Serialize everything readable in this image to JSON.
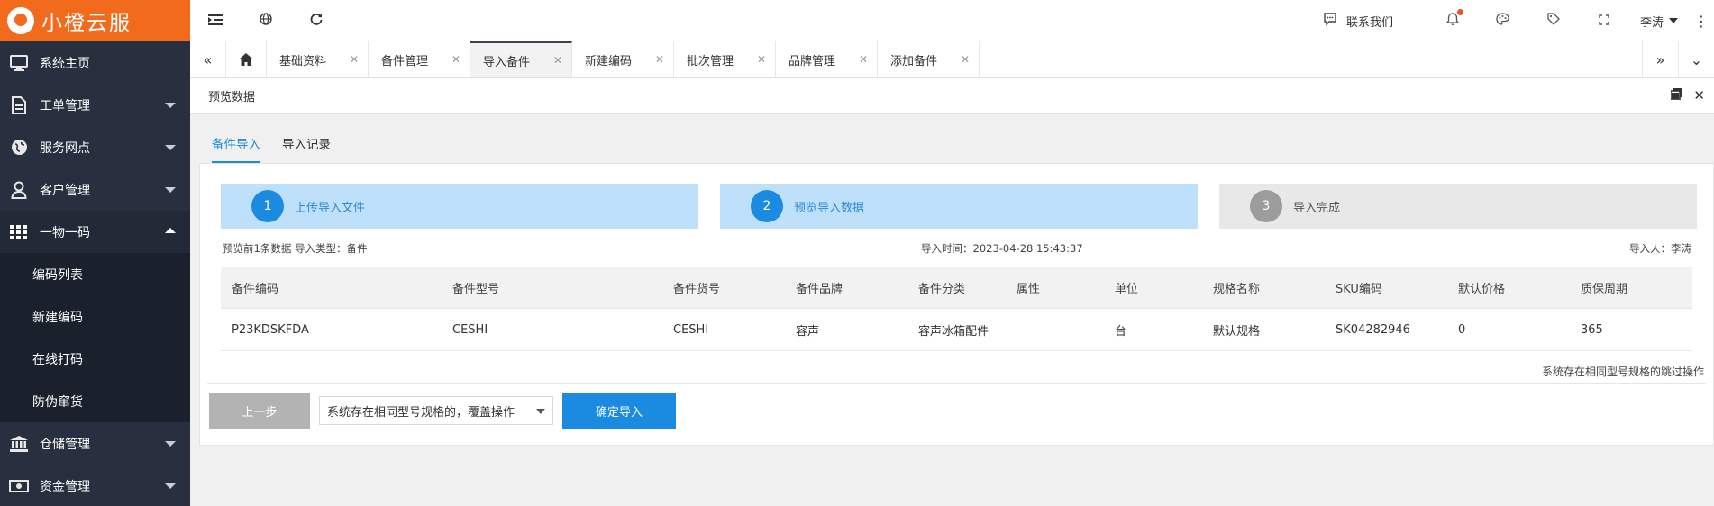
{
  "brand": {
    "name": "小橙云服",
    "color": "#f26b1d"
  },
  "sidebar": {
    "items": [
      {
        "label": "系统主页",
        "icon": "monitor-icon",
        "has_caret": false
      },
      {
        "label": "工单管理",
        "icon": "document-icon",
        "has_caret": true
      },
      {
        "label": "服务网点",
        "icon": "globe-icon",
        "has_caret": true
      },
      {
        "label": "客户管理",
        "icon": "user-icon",
        "has_caret": true
      },
      {
        "label": "一物一码",
        "icon": "grid-icon",
        "has_caret": true,
        "open": true
      }
    ],
    "subitems": [
      "编码列表",
      "新建编码",
      "在线打码",
      "防伪窜货"
    ],
    "items_after": [
      {
        "label": "仓储管理",
        "icon": "bank-icon"
      },
      {
        "label": "资金管理",
        "icon": "money-icon"
      }
    ]
  },
  "topbar": {
    "contact_label": "联系我们",
    "user_name": "李涛",
    "icons": [
      "menu-indent-icon",
      "globe-icon",
      "refresh-icon",
      "message-icon",
      "bell-icon",
      "palette-icon",
      "tag-icon",
      "fullscreen-icon",
      "more-icon"
    ]
  },
  "tabs": [
    {
      "label": "基础资料",
      "active": false
    },
    {
      "label": "备件管理",
      "active": false
    },
    {
      "label": "导入备件",
      "active": true
    },
    {
      "label": "新建编码",
      "active": false
    },
    {
      "label": "批次管理",
      "active": false
    },
    {
      "label": "品牌管理",
      "active": false
    },
    {
      "label": "添加备件",
      "active": false
    }
  ],
  "page": {
    "title": "预览数据",
    "subtabs": [
      "备件导入",
      "导入记录"
    ]
  },
  "steps": [
    {
      "num": "1",
      "label": "上传导入文件"
    },
    {
      "num": "2",
      "label": "预览导入数据"
    },
    {
      "num": "3",
      "label": "导入完成"
    }
  ],
  "meta": {
    "left": "预览前1条数据 导入类型：备件",
    "time": "导入时间：2023-04-28 15:43:37",
    "importer": "导入人：李涛"
  },
  "table": {
    "columns": [
      "备件编码",
      "备件型号",
      "备件货号",
      "备件品牌",
      "备件分类",
      "属性",
      "单位",
      "规格名称",
      "SKU编码",
      "默认价格",
      "质保周期"
    ],
    "rows": [
      [
        "P23KDSKFDA",
        "CESHI",
        "CESHI",
        "容声",
        "容声冰箱配件",
        "",
        "台",
        "默认规格",
        "SK04282946",
        "0",
        "365"
      ]
    ]
  },
  "note": "系统存在相同型号规格的跳过操作",
  "actions": {
    "prev_label": "上一步",
    "select_value": "系统存在相同型号规格的，覆盖操作",
    "confirm_label": "确定导入"
  },
  "colors": {
    "accent": "#1a8be0",
    "sidebar_bg": "#28303f",
    "step_active_bg": "#bfe0fb"
  }
}
